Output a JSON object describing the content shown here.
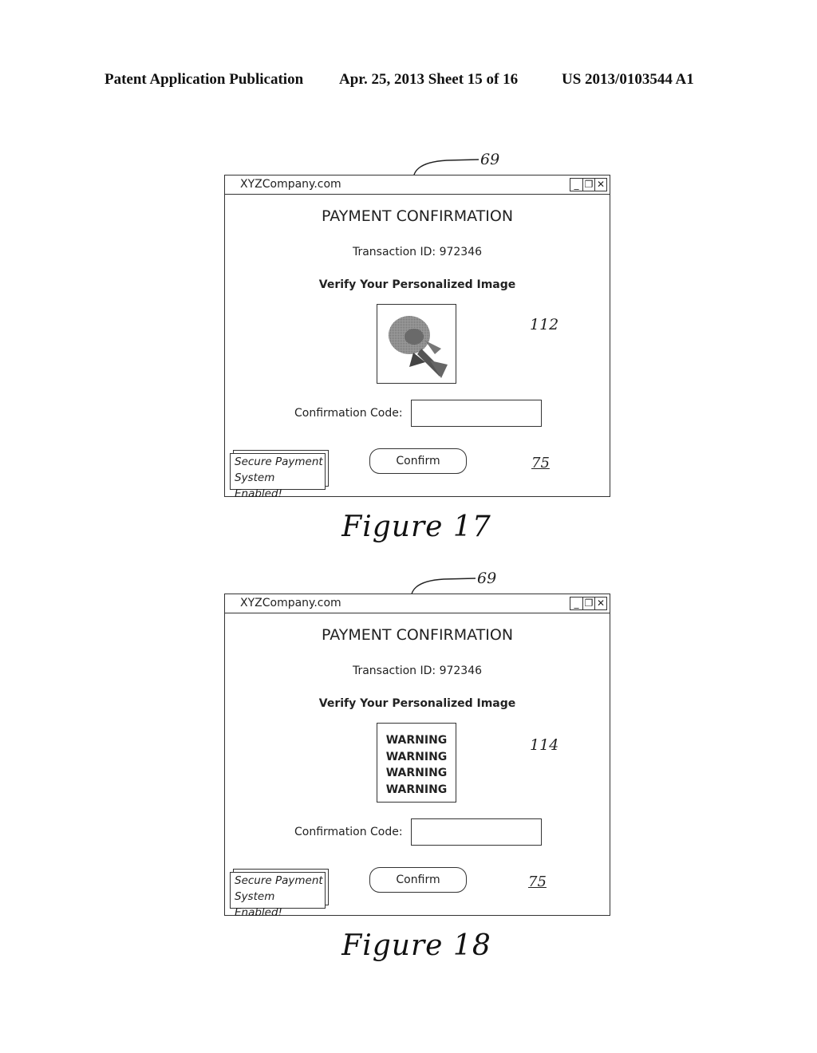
{
  "header": {
    "publication": "Patent Application Publication",
    "date_sheet": "Apr. 25, 2013  Sheet 15 of 16",
    "patent_number": "US 2013/0103544 A1"
  },
  "figures": [
    {
      "caption": "Figure 17",
      "window_ref": "69",
      "window": {
        "site": "XYZCompany.com",
        "controls": [
          "_",
          "❐",
          "✕"
        ],
        "title": "PAYMENT CONFIRMATION",
        "transaction": "Transaction ID: 972346",
        "verify_label": "Verify Your Personalized Image",
        "image_type": "rose-image",
        "image_ref": "112",
        "code_label": "Confirmation Code:",
        "code_value": "",
        "secure_badge_line1": "Secure Payment",
        "secure_badge_line2": "System Enabled!",
        "confirm_label": "Confirm",
        "ref_75": "75"
      }
    },
    {
      "caption": "Figure 18",
      "window_ref": "69",
      "window": {
        "site": "XYZCompany.com",
        "controls": [
          "_",
          "❐",
          "✕"
        ],
        "title": "PAYMENT CONFIRMATION",
        "transaction": "Transaction ID: 972346",
        "verify_label": "Verify Your Personalized Image",
        "image_type": "warning-text",
        "warning_lines": [
          "WARNING",
          "WARNING",
          "WARNING",
          "WARNING"
        ],
        "image_ref": "114",
        "code_label": "Confirmation Code:",
        "code_value": "",
        "secure_badge_line1": "Secure Payment",
        "secure_badge_line2": "System Enabled!",
        "confirm_label": "Confirm",
        "ref_75": "75"
      }
    }
  ]
}
